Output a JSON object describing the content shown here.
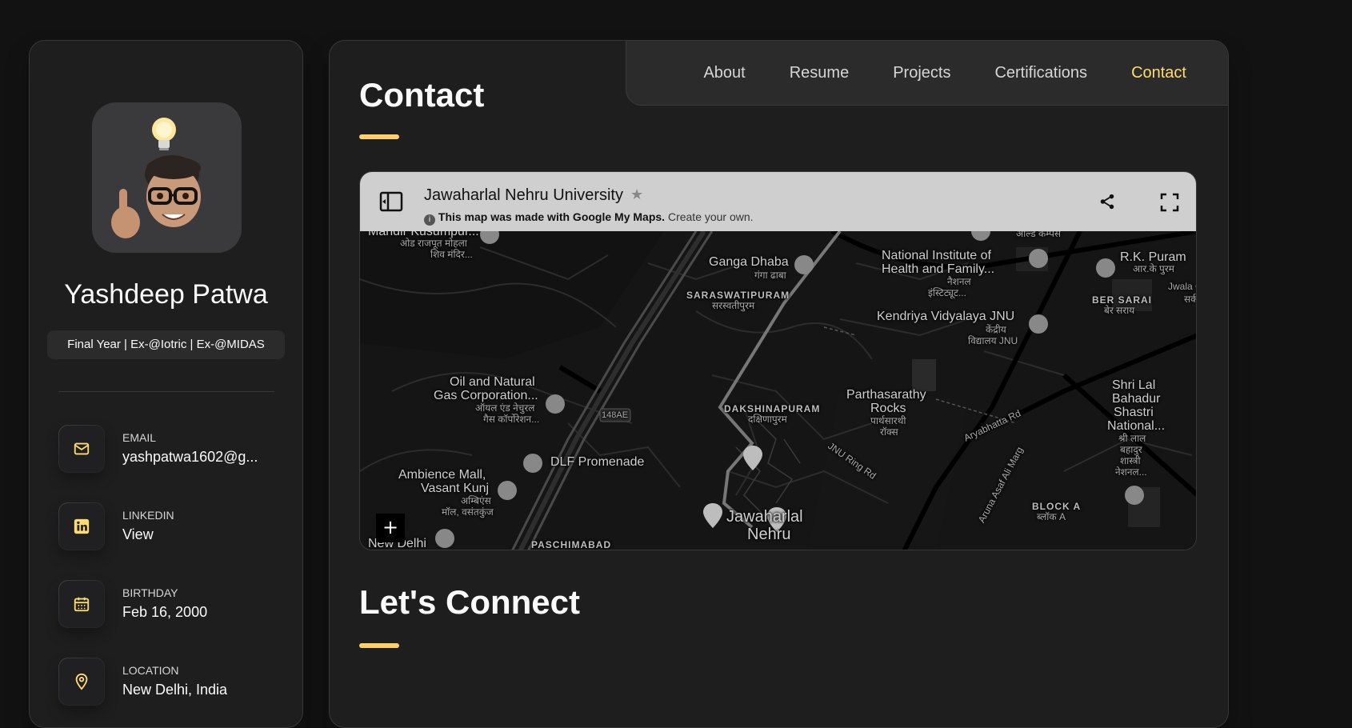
{
  "profile": {
    "name": "Yashdeep Patwa",
    "title": "Final Year | Ex-@Iotric | Ex-@MIDAS"
  },
  "contacts": [
    {
      "label": "EMAIL",
      "value": "yashpatwa1602@g...",
      "icon": "mail-icon"
    },
    {
      "label": "LINKEDIN",
      "value": "View",
      "icon": "linkedin-icon"
    },
    {
      "label": "BIRTHDAY",
      "value": "Feb 16, 2000",
      "icon": "calendar-icon"
    },
    {
      "label": "LOCATION",
      "value": "New Delhi, India",
      "icon": "location-pin-icon"
    }
  ],
  "nav": {
    "items": [
      "About",
      "Resume",
      "Projects",
      "Certifications",
      "Contact"
    ],
    "active": "Contact"
  },
  "page": {
    "title": "Contact",
    "connect_title": "Let's Connect"
  },
  "map": {
    "title": "Jawaharlal Nehru University",
    "notice_bold": "This map was made with Google My Maps.",
    "notice_link": "Create your own.",
    "zoom_in": "+",
    "labels": {
      "kusumpur": "Mandir Kusumpur...",
      "kusumpur_hi1": "ओड राजपूत मोहला",
      "kusumpur_hi2": "शिव मंदिर...",
      "ganga": "Ganga Dhaba",
      "ganga_hi": "गंगा ढाबा",
      "niohfw1": "National Institute of",
      "niohfw2": "Health and Family...",
      "niohfw_hi1": "नैशनल",
      "niohfw_hi2": "इंस्टिट्यूट...",
      "allied": "अल्डि कम्पस",
      "rkpuram": "R.K. Puram",
      "rkpuram_hi": "आर.के पुरम",
      "jwala": "Jwala C",
      "jwala_hi": "सर्क",
      "saraswati": "SARASWATIPURAM",
      "saraswati_hi": "सरस्वतीपुरम",
      "kv1": "Kendriya Vidyalaya JNU",
      "kv_hi1": "केंद्रीय",
      "kv_hi2": "विद्यालय JNU",
      "bersarai": "BER SARAI",
      "bersarai_hi": "बेर सराय",
      "ongc1": "Oil and Natural",
      "ongc2": "Gas Corporation...",
      "ongc_hi1": "ऑयल एंड नेचुरल",
      "ongc_hi2": "गैस कॉर्पोरेशन...",
      "road148": "148AE",
      "dakshin": "DAKSHINAPURAM",
      "dakshin_hi": "दक्षिणापुरम",
      "partha1": "Parthasarathy",
      "partha2": "Rocks",
      "partha_hi1": "पार्थसारथी",
      "partha_hi2": "रॉक्स",
      "shastri1": "Shri Lal",
      "shastri2": "Bahadur",
      "shastri3": "Shastri",
      "shastri4": "National...",
      "shastri_hi1": "श्री लाल",
      "shastri_hi2": "बहादुर",
      "shastri_hi3": "शास्त्री",
      "shastri_hi4": "नेशनल...",
      "dlf": "DLF Promenade",
      "ambience1": "Ambience Mall,",
      "ambience2": "Vasant Kunj",
      "ambience_hi1": "अम्बिएंस",
      "ambience_hi2": "मॉल, वसंतकुंज",
      "jnuring": "JNU Ring Rd",
      "aryabhatta": "Aryabhatta Rd",
      "arunaasaf": "Aruna Asaf Ali Marg",
      "blocka": "BLOCK A",
      "blocka_hi": "ब्लॉक A",
      "jnu1": "Jawaharlal",
      "jnu2": "Nehru",
      "paschimabad": "PASCHIMABAD",
      "newdelhi": "New Delhi"
    }
  },
  "colors": {
    "accent": "#ffdb70",
    "bg": "#121212",
    "panel": "#1e1e1f"
  }
}
